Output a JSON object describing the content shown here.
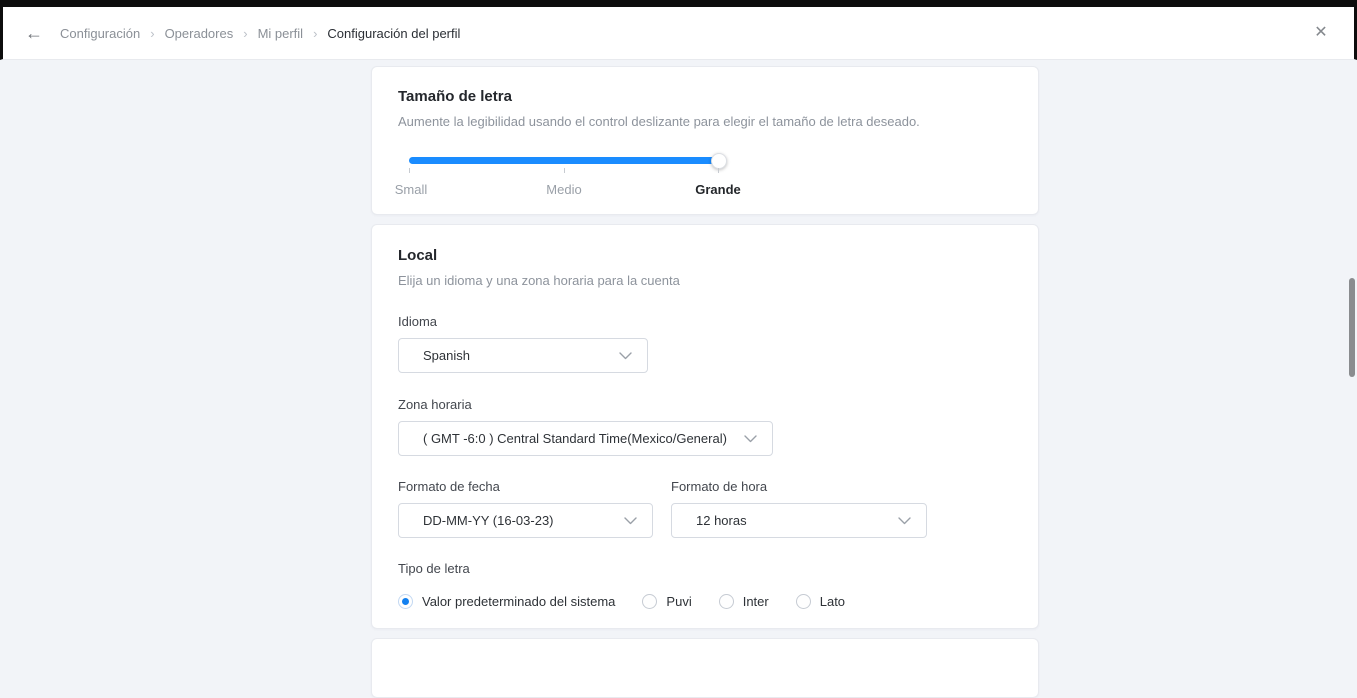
{
  "header": {
    "icons": {
      "back": "←",
      "close": "✕",
      "separator": "›"
    },
    "breadcrumb": [
      {
        "label": "Configuración"
      },
      {
        "label": "Operadores"
      },
      {
        "label": "Mi perfil"
      },
      {
        "label": "Configuración del perfil"
      }
    ]
  },
  "font_size_card": {
    "title": "Tamaño de letra",
    "description": "Aumente la legibilidad usando el control deslizante para elegir el tamaño de letra deseado.",
    "slider": {
      "options": [
        "Small",
        "Medio",
        "Grande"
      ],
      "selected": "Grande",
      "value_percent": 100,
      "track_color": "#1a8cff"
    }
  },
  "local_card": {
    "title": "Local",
    "description": "Elija un idioma y una zona horaria para la cuenta",
    "idioma": {
      "label": "Idioma",
      "value": "Spanish"
    },
    "zona_horaria": {
      "label": "Zona horaria",
      "value": "( GMT -6:0 ) Central Standard Time(Mexico/General)"
    },
    "formato_fecha": {
      "label": "Formato de fecha",
      "value": "DD-MM-YY (16-03-23)"
    },
    "formato_hora": {
      "label": "Formato de hora",
      "value": "12 horas"
    },
    "tipo_de_letra": {
      "label": "Tipo de letra",
      "options": [
        {
          "label": "Valor predeterminado del sistema",
          "selected": true
        },
        {
          "label": "Puvi",
          "selected": false
        },
        {
          "label": "Inter",
          "selected": false
        },
        {
          "label": "Lato",
          "selected": false
        }
      ]
    }
  },
  "colors": {
    "accent": "#1a8cff",
    "background": "#f2f4f8",
    "scrollbar": "#8a8c8f"
  }
}
